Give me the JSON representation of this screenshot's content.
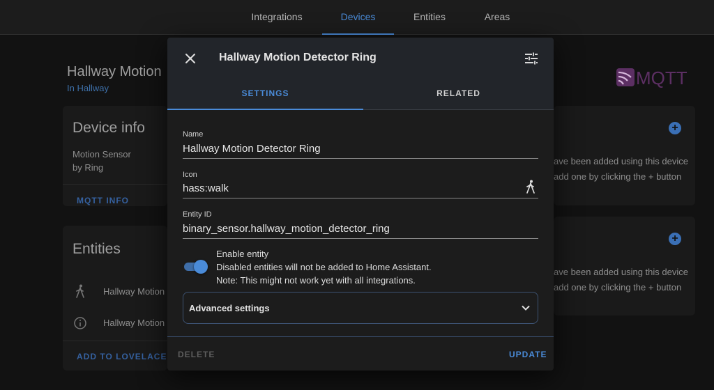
{
  "topbar": {
    "tabs": [
      {
        "label": "Integrations"
      },
      {
        "label": "Devices"
      },
      {
        "label": "Entities"
      },
      {
        "label": "Areas"
      }
    ],
    "active_tab": "Devices"
  },
  "background": {
    "device_title": "Hallway Motion",
    "device_area": "In Hallway",
    "logo_text": "MQTT",
    "device_info": {
      "title": "Device info",
      "model": "Motion Sensor",
      "manufacturer": "by Ring",
      "action": "MQTT INFO"
    },
    "entities": {
      "title": "Entities",
      "items": [
        {
          "label": "Hallway Motion",
          "icon": "walk-icon"
        },
        {
          "label": "Hallway Motion",
          "icon": "info-icon"
        }
      ],
      "action": "ADD TO LOVELACE"
    },
    "right_cards": [
      {
        "line1": "ave been added using this device",
        "line2": "add one by clicking the + button"
      },
      {
        "line1": "ave been added using this device",
        "line2": "add one by clicking the + button"
      }
    ]
  },
  "dialog": {
    "title": "Hallway Motion Detector Ring",
    "tabs": [
      {
        "label": "SETTINGS"
      },
      {
        "label": "RELATED"
      }
    ],
    "active_tab": "SETTINGS",
    "fields": {
      "name": {
        "label": "Name",
        "value": "Hallway Motion Detector Ring"
      },
      "icon": {
        "label": "Icon",
        "value": "hass:walk"
      },
      "entity_id": {
        "label": "Entity ID",
        "value": "binary_sensor.hallway_motion_detector_ring"
      }
    },
    "enable_entity": {
      "label": "Enable entity",
      "enabled": true,
      "note1": "Disabled entities will not be added to Home Assistant.",
      "note2": "Note: This might not work yet with all integrations."
    },
    "advanced": {
      "label": "Advanced settings"
    },
    "delete_label": "DELETE",
    "update_label": "UPDATE"
  },
  "colors": {
    "accent": "#4a8bd8",
    "background": "#111111",
    "dialog": "#1c1c1c"
  }
}
